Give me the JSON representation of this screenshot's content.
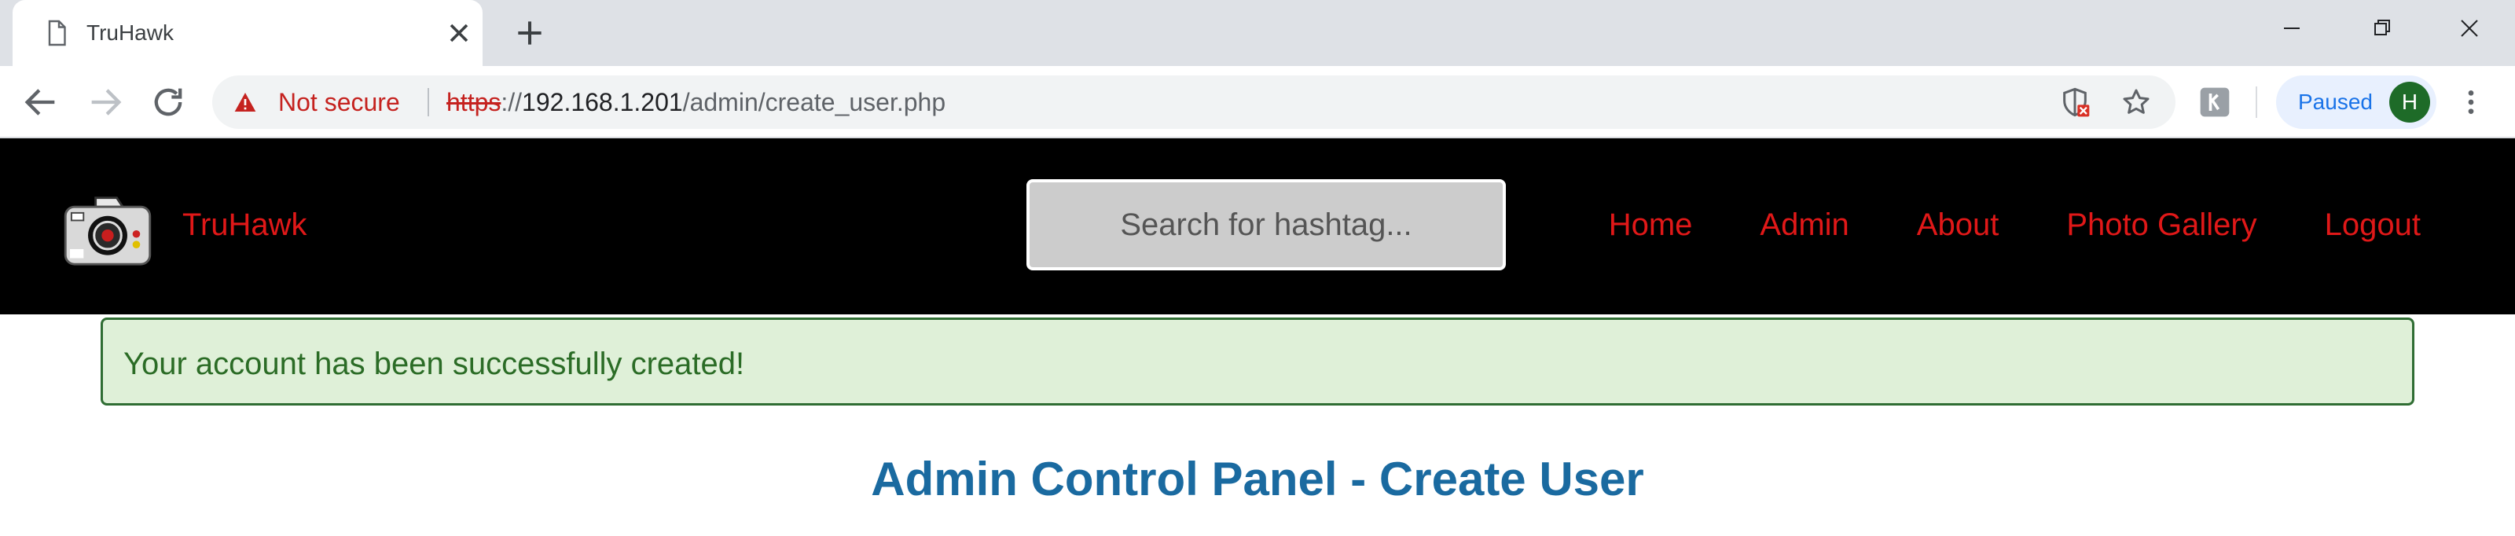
{
  "browser": {
    "tab": {
      "title": "TruHawk"
    },
    "address_bar": {
      "security_label": "Not secure",
      "url_scheme": "https",
      "url_sep": "://",
      "url_host": "192.168.1.201",
      "url_path": "/admin/create_user.php"
    },
    "profile": {
      "label": "Paused",
      "avatar_initial": "H",
      "avatar_color": "#1e6b28"
    }
  },
  "site": {
    "brand": "TruHawk",
    "brand_color": "#e01818",
    "search": {
      "placeholder": "Search for hashtag..."
    },
    "nav": [
      {
        "label": "Home"
      },
      {
        "label": "Admin"
      },
      {
        "label": "About"
      },
      {
        "label": "Photo Gallery"
      },
      {
        "label": "Logout"
      }
    ]
  },
  "alert": {
    "message": "Your account has been successfully created!",
    "bg_color": "#dff0d8"
  },
  "main": {
    "title": "Admin Control Panel - Create User",
    "title_color": "#1a6aa0"
  }
}
